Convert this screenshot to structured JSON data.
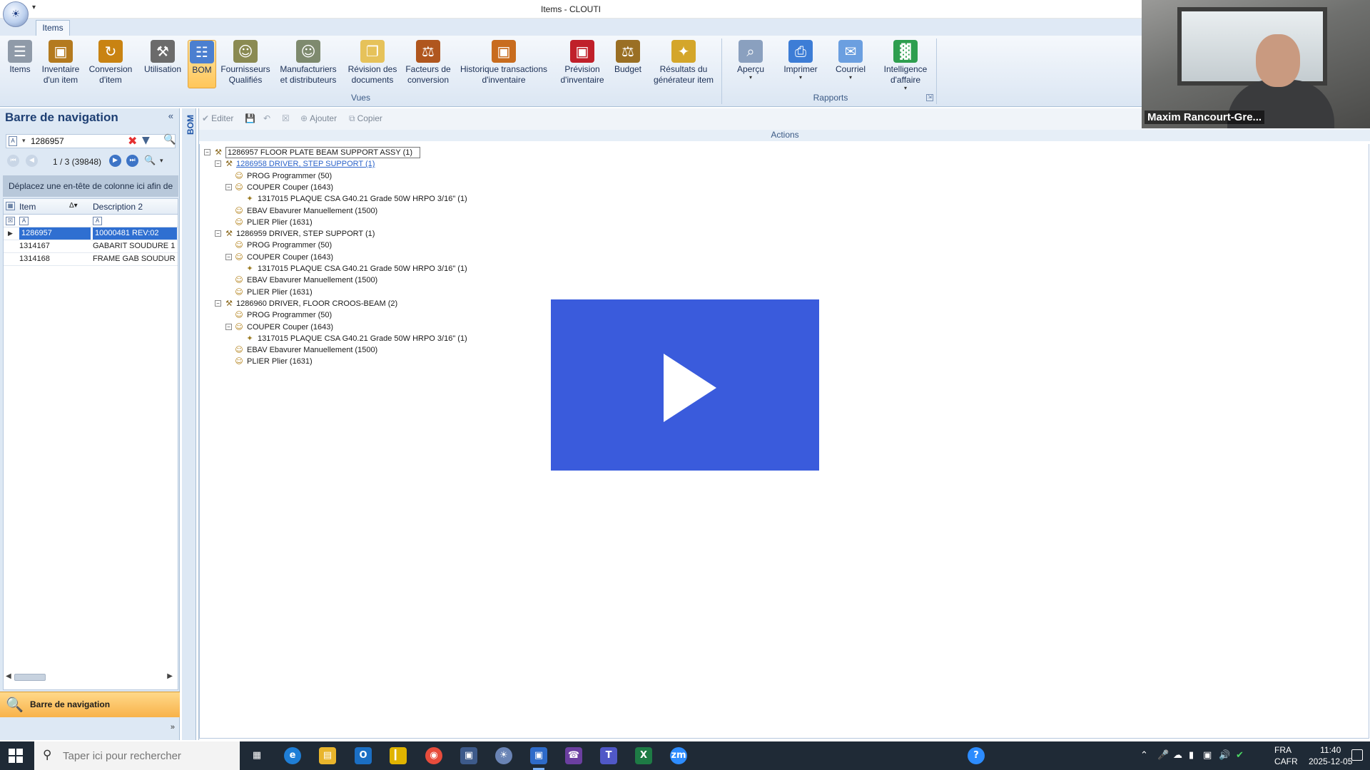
{
  "window": {
    "title": "Items - CLOUTI"
  },
  "ribbon": {
    "tab": "Items",
    "vues": {
      "label": "Vues",
      "buttons": [
        {
          "line1": "Items",
          "line2": ""
        },
        {
          "line1": "Inventaire",
          "line2": "d'un item"
        },
        {
          "line1": "Conversion",
          "line2": "d'item"
        },
        {
          "line1": "Utilisation",
          "line2": ""
        },
        {
          "line1": "BOM",
          "line2": ""
        },
        {
          "line1": "Fournisseurs",
          "line2": "Qualifiés"
        },
        {
          "line1": "Manufacturiers",
          "line2": "et distributeurs"
        },
        {
          "line1": "Révision des",
          "line2": "documents"
        },
        {
          "line1": "Facteurs de",
          "line2": "conversion"
        },
        {
          "line1": "Historique transactions",
          "line2": "d'inventaire"
        },
        {
          "line1": "Prévision",
          "line2": "d'inventaire"
        },
        {
          "line1": "Budget",
          "line2": ""
        },
        {
          "line1": "Résultats du",
          "line2": "générateur item"
        }
      ]
    },
    "rapports": {
      "label": "Rapports",
      "buttons": [
        {
          "line1": "Aperçu",
          "line2": ""
        },
        {
          "line1": "Imprimer",
          "line2": ""
        },
        {
          "line1": "Courriel",
          "line2": ""
        },
        {
          "line1": "Intelligence",
          "line2": "d'affaire"
        }
      ]
    }
  },
  "icons": {
    "vues": [
      "notepad-icon",
      "box-icon",
      "box-cycle-icon",
      "tools-icon",
      "org-chart-icon",
      "supplier-icon",
      "manufacturer-icon",
      "folder-icon",
      "scale-box-icon",
      "history-box-icon",
      "forecast-box-icon",
      "budget-scale-icon",
      "generator-icon"
    ],
    "rapports": [
      "preview-icon",
      "printer-icon",
      "email-icon",
      "chart-icon"
    ]
  },
  "colors": {
    "accent_blue": "#2f6fd1",
    "active_orange": "#f8b24a",
    "play_overlay": "#3a5bdc"
  },
  "nav": {
    "title": "Barre de navigation",
    "search_value": "1286957",
    "pager": "1 / 3 (39848)",
    "group_hint": "Déplacez une en-tête de colonne ici afin de",
    "columns": [
      "Item",
      "Description 2"
    ],
    "rows": [
      {
        "item": "1286957",
        "desc": "10000481 REV:02",
        "selected": true
      },
      {
        "item": "1314167",
        "desc": "GABARIT SOUDURE 1",
        "selected": false
      },
      {
        "item": "1314168",
        "desc": "FRAME GAB SOUDUR",
        "selected": false
      }
    ],
    "bottom_label": "Barre de navigation"
  },
  "bom": {
    "side_label": "BOM",
    "toolbar": {
      "edit": "Editer",
      "add": "Ajouter",
      "copy": "Copier"
    },
    "actions_label": "Actions",
    "tree": [
      {
        "text": "1286957 FLOOR PLATE BEAM SUPPORT ASSY (1)",
        "type": "root",
        "level": 0
      },
      {
        "text": "1286958 DRIVER, STEP SUPPORT (1)",
        "type": "assy",
        "level": 1,
        "link": true
      },
      {
        "text": "PROG Programmer (50)",
        "type": "op",
        "level": 2
      },
      {
        "text": "COUPER Couper (1643)",
        "type": "op",
        "level": 2,
        "expand": true
      },
      {
        "text": "1317015 PLAQUE CSA G40.21 Grade 50W  HRPO  3/16\" (1)",
        "type": "mat",
        "level": 3
      },
      {
        "text": "EBAV Ebavurer Manuellement (1500)",
        "type": "op",
        "level": 2
      },
      {
        "text": "PLIER Plier (1631)",
        "type": "op",
        "level": 2
      },
      {
        "text": "1286959 DRIVER, STEP SUPPORT (1)",
        "type": "assy",
        "level": 1
      },
      {
        "text": "PROG Programmer (50)",
        "type": "op",
        "level": 2
      },
      {
        "text": "COUPER Couper (1643)",
        "type": "op",
        "level": 2,
        "expand": true
      },
      {
        "text": "1317015 PLAQUE CSA G40.21 Grade 50W  HRPO  3/16\" (1)",
        "type": "mat",
        "level": 3
      },
      {
        "text": "EBAV Ebavurer Manuellement (1500)",
        "type": "op",
        "level": 2
      },
      {
        "text": "PLIER Plier (1631)",
        "type": "op",
        "level": 2
      },
      {
        "text": "1286960 DRIVER, FLOOR CROOS-BEAM (2)",
        "type": "assy",
        "level": 1
      },
      {
        "text": "PROG Programmer (50)",
        "type": "op",
        "level": 2
      },
      {
        "text": "COUPER Couper (1643)",
        "type": "op",
        "level": 2,
        "expand": true
      },
      {
        "text": "1317015 PLAQUE CSA G40.21 Grade 50W  HRPO  3/16\" (1)",
        "type": "mat",
        "level": 3
      },
      {
        "text": "EBAV Ebavurer Manuellement (1500)",
        "type": "op",
        "level": 2
      },
      {
        "text": "PLIER Plier (1631)",
        "type": "op",
        "level": 2
      }
    ]
  },
  "webcam": {
    "name": "Maxim Rancourt-Gre..."
  },
  "taskbar": {
    "search_placeholder": "Taper ici pour rechercher",
    "lang1": "FRA",
    "lang2": "CAFR",
    "time": "11:40",
    "date": "2025-12-05"
  }
}
